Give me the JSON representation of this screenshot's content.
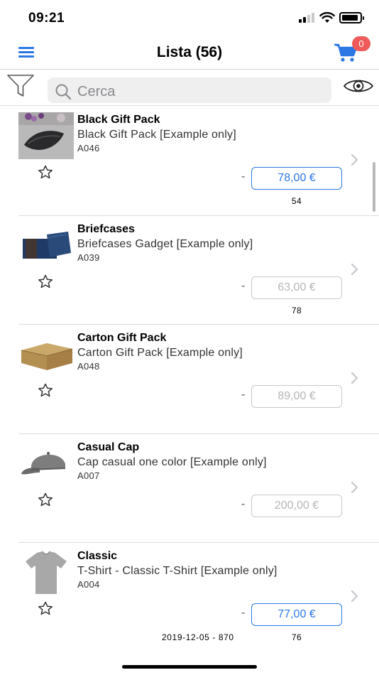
{
  "status": {
    "time": "09:21"
  },
  "nav": {
    "title": "Lista (56)",
    "cart_count": "0"
  },
  "search": {
    "placeholder": "Cerca"
  },
  "products": [
    {
      "name": "Black Gift Pack",
      "description": "Black Gift Pack [Example only]",
      "code": "A046",
      "dash": "-",
      "price": "78,00 €",
      "price_active": true,
      "quantity": "54",
      "note": ""
    },
    {
      "name": "Briefcases",
      "description": "Briefcases Gadget [Example only]",
      "code": "A039",
      "dash": "-",
      "price": "63,00 €",
      "price_active": false,
      "quantity": "78",
      "note": ""
    },
    {
      "name": "Carton Gift Pack",
      "description": "Carton Gift Pack [Example only]",
      "code": "A048",
      "dash": "-",
      "price": "89,00 €",
      "price_active": false,
      "quantity": "",
      "note": ""
    },
    {
      "name": "Casual Cap",
      "description": "Cap casual one color [Example only]",
      "code": "A007",
      "dash": "-",
      "price": "200,00 €",
      "price_active": false,
      "quantity": "",
      "note": ""
    },
    {
      "name": "Classic",
      "description": "T-Shirt - Classic T-Shirt [Example only]",
      "code": "A004",
      "dash": "-",
      "price": "77,00 €",
      "price_active": true,
      "quantity": "76",
      "note": "2019-12-05 - 870"
    }
  ],
  "icons": {
    "menu": "menu-icon",
    "cart": "cart-icon",
    "filter": "filter-icon",
    "search": "search-icon",
    "eye": "eye-icon",
    "star": "star-outline-icon",
    "chevron": "chevron-right-icon"
  },
  "colors": {
    "accent": "#2b78e4",
    "badge": "#f05a5a",
    "disabled_price": "#b5b5b5"
  }
}
